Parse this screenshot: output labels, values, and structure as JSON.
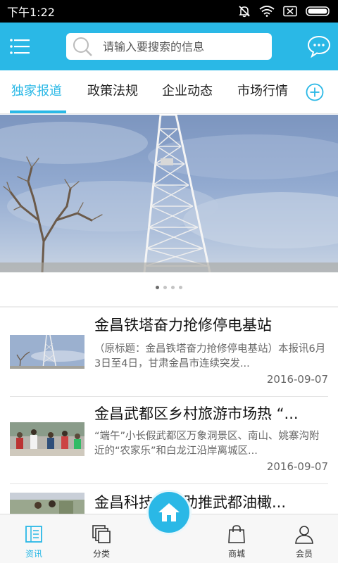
{
  "status_bar": {
    "time": "下午1:22",
    "icons": [
      "mute-icon",
      "wifi-icon",
      "no-sim-icon",
      "battery-icon"
    ]
  },
  "header": {
    "search_placeholder": "请输入要搜索的信息",
    "accent_color": "#2ab8e6"
  },
  "tabs": [
    {
      "label": "独家报道",
      "active": true
    },
    {
      "label": "政策法规",
      "active": false
    },
    {
      "label": "企业动态",
      "active": false
    },
    {
      "label": "市场行情",
      "active": false
    }
  ],
  "banner": {
    "dots_total": 4,
    "active_dot": 1
  },
  "news": [
    {
      "title": "金昌铁塔奋力抢修停电基站",
      "summary": "（原标题：金昌铁塔奋力抢修停电基站）本报讯6月3日至4日，甘肃金昌市连续突发...",
      "date": "2016-09-07"
    },
    {
      "title": "金昌武都区乡村旅游市场热 “...",
      "summary": "“端午”小长假武都区万象洞景区、南山、姚寨沟附近的“农家乐”和白龙江沿岸离城区...",
      "date": "2016-09-07"
    },
    {
      "title": "金昌科技创新助推武都油橄...",
      "summary": "",
      "date": ""
    }
  ],
  "bottom_nav": [
    {
      "label": "资讯",
      "icon": "news-icon",
      "active": true
    },
    {
      "label": "分类",
      "icon": "category-icon",
      "active": false
    },
    {
      "label": "",
      "icon": "home-icon",
      "active": false
    },
    {
      "label": "商城",
      "icon": "shop-bag-icon",
      "active": false
    },
    {
      "label": "会员",
      "icon": "member-icon",
      "active": false
    }
  ]
}
